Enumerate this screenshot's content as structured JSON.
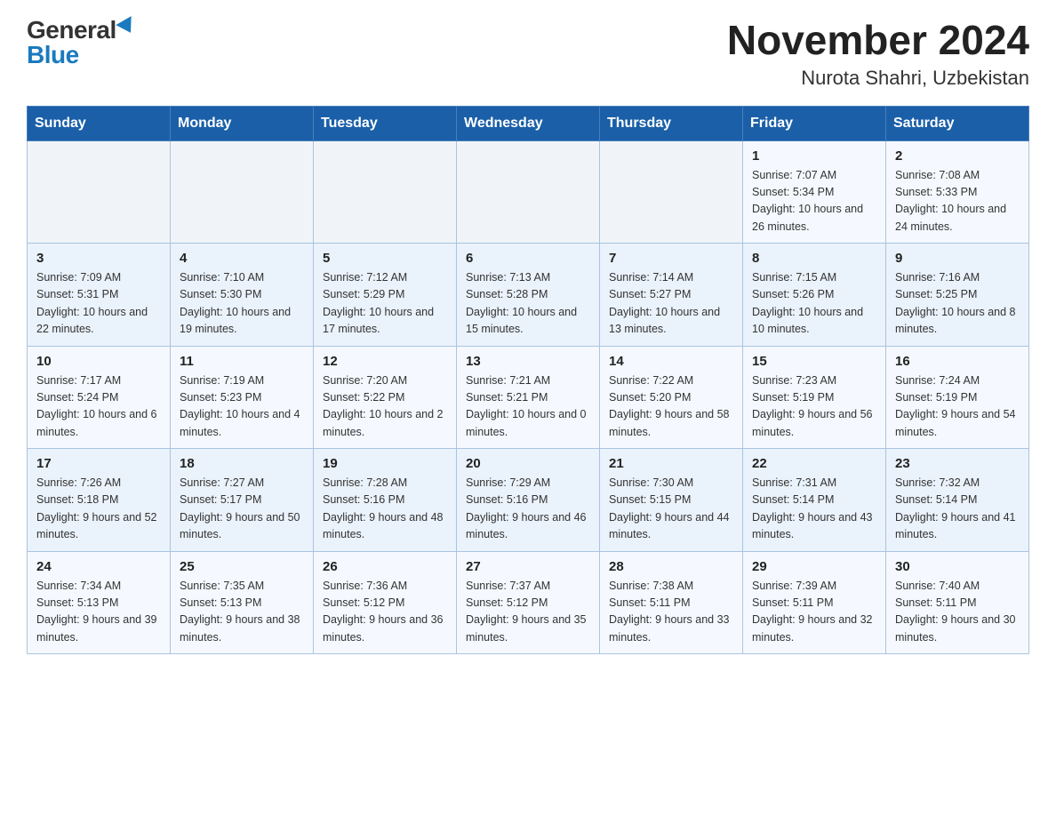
{
  "header": {
    "logo_general": "General",
    "logo_blue": "Blue",
    "title": "November 2024",
    "subtitle": "Nurota Shahri, Uzbekistan"
  },
  "weekdays": [
    "Sunday",
    "Monday",
    "Tuesday",
    "Wednesday",
    "Thursday",
    "Friday",
    "Saturday"
  ],
  "weeks": [
    [
      {
        "day": "",
        "sunrise": "",
        "sunset": "",
        "daylight": ""
      },
      {
        "day": "",
        "sunrise": "",
        "sunset": "",
        "daylight": ""
      },
      {
        "day": "",
        "sunrise": "",
        "sunset": "",
        "daylight": ""
      },
      {
        "day": "",
        "sunrise": "",
        "sunset": "",
        "daylight": ""
      },
      {
        "day": "",
        "sunrise": "",
        "sunset": "",
        "daylight": ""
      },
      {
        "day": "1",
        "sunrise": "Sunrise: 7:07 AM",
        "sunset": "Sunset: 5:34 PM",
        "daylight": "Daylight: 10 hours and 26 minutes."
      },
      {
        "day": "2",
        "sunrise": "Sunrise: 7:08 AM",
        "sunset": "Sunset: 5:33 PM",
        "daylight": "Daylight: 10 hours and 24 minutes."
      }
    ],
    [
      {
        "day": "3",
        "sunrise": "Sunrise: 7:09 AM",
        "sunset": "Sunset: 5:31 PM",
        "daylight": "Daylight: 10 hours and 22 minutes."
      },
      {
        "day": "4",
        "sunrise": "Sunrise: 7:10 AM",
        "sunset": "Sunset: 5:30 PM",
        "daylight": "Daylight: 10 hours and 19 minutes."
      },
      {
        "day": "5",
        "sunrise": "Sunrise: 7:12 AM",
        "sunset": "Sunset: 5:29 PM",
        "daylight": "Daylight: 10 hours and 17 minutes."
      },
      {
        "day": "6",
        "sunrise": "Sunrise: 7:13 AM",
        "sunset": "Sunset: 5:28 PM",
        "daylight": "Daylight: 10 hours and 15 minutes."
      },
      {
        "day": "7",
        "sunrise": "Sunrise: 7:14 AM",
        "sunset": "Sunset: 5:27 PM",
        "daylight": "Daylight: 10 hours and 13 minutes."
      },
      {
        "day": "8",
        "sunrise": "Sunrise: 7:15 AM",
        "sunset": "Sunset: 5:26 PM",
        "daylight": "Daylight: 10 hours and 10 minutes."
      },
      {
        "day": "9",
        "sunrise": "Sunrise: 7:16 AM",
        "sunset": "Sunset: 5:25 PM",
        "daylight": "Daylight: 10 hours and 8 minutes."
      }
    ],
    [
      {
        "day": "10",
        "sunrise": "Sunrise: 7:17 AM",
        "sunset": "Sunset: 5:24 PM",
        "daylight": "Daylight: 10 hours and 6 minutes."
      },
      {
        "day": "11",
        "sunrise": "Sunrise: 7:19 AM",
        "sunset": "Sunset: 5:23 PM",
        "daylight": "Daylight: 10 hours and 4 minutes."
      },
      {
        "day": "12",
        "sunrise": "Sunrise: 7:20 AM",
        "sunset": "Sunset: 5:22 PM",
        "daylight": "Daylight: 10 hours and 2 minutes."
      },
      {
        "day": "13",
        "sunrise": "Sunrise: 7:21 AM",
        "sunset": "Sunset: 5:21 PM",
        "daylight": "Daylight: 10 hours and 0 minutes."
      },
      {
        "day": "14",
        "sunrise": "Sunrise: 7:22 AM",
        "sunset": "Sunset: 5:20 PM",
        "daylight": "Daylight: 9 hours and 58 minutes."
      },
      {
        "day": "15",
        "sunrise": "Sunrise: 7:23 AM",
        "sunset": "Sunset: 5:19 PM",
        "daylight": "Daylight: 9 hours and 56 minutes."
      },
      {
        "day": "16",
        "sunrise": "Sunrise: 7:24 AM",
        "sunset": "Sunset: 5:19 PM",
        "daylight": "Daylight: 9 hours and 54 minutes."
      }
    ],
    [
      {
        "day": "17",
        "sunrise": "Sunrise: 7:26 AM",
        "sunset": "Sunset: 5:18 PM",
        "daylight": "Daylight: 9 hours and 52 minutes."
      },
      {
        "day": "18",
        "sunrise": "Sunrise: 7:27 AM",
        "sunset": "Sunset: 5:17 PM",
        "daylight": "Daylight: 9 hours and 50 minutes."
      },
      {
        "day": "19",
        "sunrise": "Sunrise: 7:28 AM",
        "sunset": "Sunset: 5:16 PM",
        "daylight": "Daylight: 9 hours and 48 minutes."
      },
      {
        "day": "20",
        "sunrise": "Sunrise: 7:29 AM",
        "sunset": "Sunset: 5:16 PM",
        "daylight": "Daylight: 9 hours and 46 minutes."
      },
      {
        "day": "21",
        "sunrise": "Sunrise: 7:30 AM",
        "sunset": "Sunset: 5:15 PM",
        "daylight": "Daylight: 9 hours and 44 minutes."
      },
      {
        "day": "22",
        "sunrise": "Sunrise: 7:31 AM",
        "sunset": "Sunset: 5:14 PM",
        "daylight": "Daylight: 9 hours and 43 minutes."
      },
      {
        "day": "23",
        "sunrise": "Sunrise: 7:32 AM",
        "sunset": "Sunset: 5:14 PM",
        "daylight": "Daylight: 9 hours and 41 minutes."
      }
    ],
    [
      {
        "day": "24",
        "sunrise": "Sunrise: 7:34 AM",
        "sunset": "Sunset: 5:13 PM",
        "daylight": "Daylight: 9 hours and 39 minutes."
      },
      {
        "day": "25",
        "sunrise": "Sunrise: 7:35 AM",
        "sunset": "Sunset: 5:13 PM",
        "daylight": "Daylight: 9 hours and 38 minutes."
      },
      {
        "day": "26",
        "sunrise": "Sunrise: 7:36 AM",
        "sunset": "Sunset: 5:12 PM",
        "daylight": "Daylight: 9 hours and 36 minutes."
      },
      {
        "day": "27",
        "sunrise": "Sunrise: 7:37 AM",
        "sunset": "Sunset: 5:12 PM",
        "daylight": "Daylight: 9 hours and 35 minutes."
      },
      {
        "day": "28",
        "sunrise": "Sunrise: 7:38 AM",
        "sunset": "Sunset: 5:11 PM",
        "daylight": "Daylight: 9 hours and 33 minutes."
      },
      {
        "day": "29",
        "sunrise": "Sunrise: 7:39 AM",
        "sunset": "Sunset: 5:11 PM",
        "daylight": "Daylight: 9 hours and 32 minutes."
      },
      {
        "day": "30",
        "sunrise": "Sunrise: 7:40 AM",
        "sunset": "Sunset: 5:11 PM",
        "daylight": "Daylight: 9 hours and 30 minutes."
      }
    ]
  ]
}
